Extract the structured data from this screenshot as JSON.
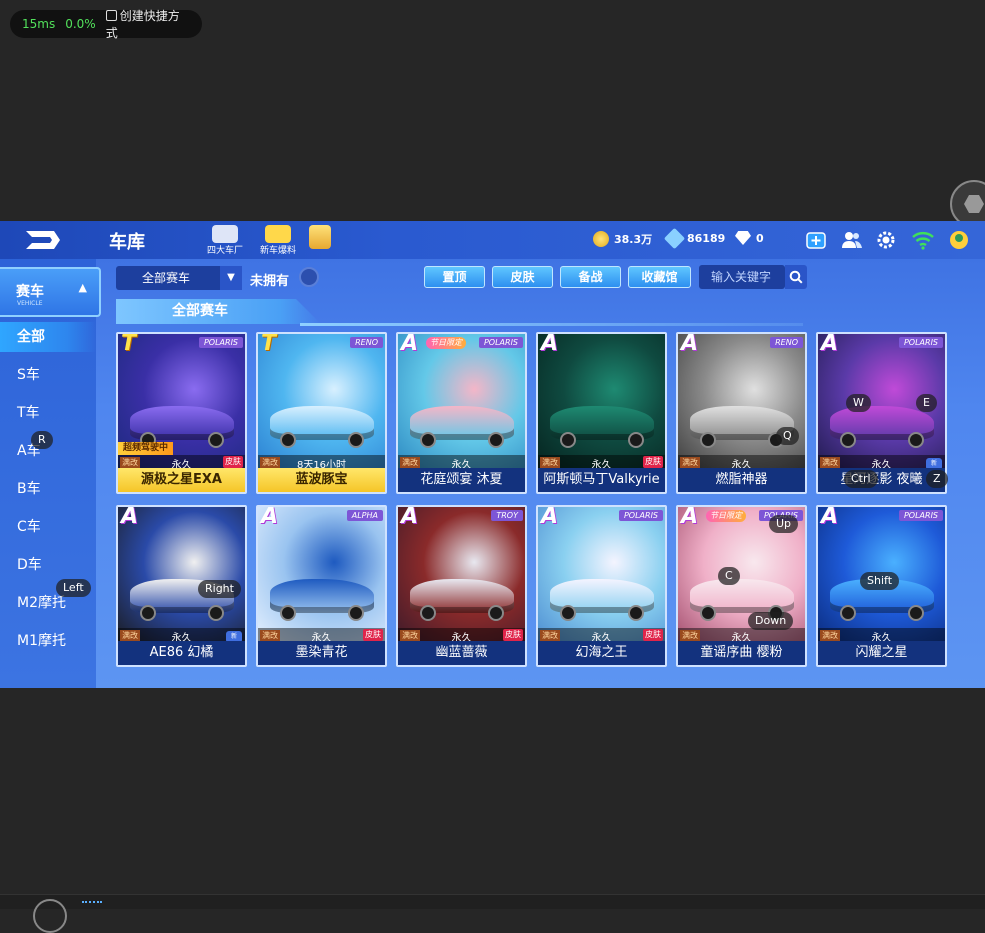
{
  "overlay": {
    "latency": "15ms",
    "loss": "0.0%",
    "shortcut_label": "创建快捷方式"
  },
  "header": {
    "title": "车库",
    "nav_icons": [
      {
        "label": "四大车厂",
        "icon": "factory-icon"
      },
      {
        "label": "新车爆料",
        "icon": "new-car-icon"
      },
      {
        "label": "",
        "icon": "gift-icon"
      }
    ],
    "currencies": [
      {
        "icon": "coin-icon",
        "value": "38.3万"
      },
      {
        "icon": "gem-icon",
        "value": "86189"
      },
      {
        "icon": "diamond-icon",
        "value": "0"
      }
    ],
    "right_icons": [
      "add-icon",
      "friends-icon",
      "settings-icon",
      "wifi-icon",
      "avatar-icon"
    ]
  },
  "sidebar": {
    "category": {
      "title": "赛车",
      "subtitle": "VEHICLE"
    },
    "items": [
      {
        "label": "全部",
        "active": true
      },
      {
        "label": "S车",
        "active": false
      },
      {
        "label": "T车",
        "active": false
      },
      {
        "label": "A车",
        "active": false
      },
      {
        "label": "B车",
        "active": false
      },
      {
        "label": "C车",
        "active": false
      },
      {
        "label": "D车",
        "active": false
      },
      {
        "label": "M2摩托",
        "active": false
      },
      {
        "label": "M1摩托",
        "active": false
      }
    ]
  },
  "filters": {
    "dropdown_value": "全部赛车",
    "unowned_label": "未拥有",
    "buttons": [
      "置顶",
      "皮肤",
      "备战",
      "收藏馆"
    ],
    "search_placeholder": "输入关键字"
  },
  "section_title": "全部赛车",
  "cars": [
    {
      "name": "源极之星EXA",
      "grade": "T",
      "brand": "POLARIS",
      "mod": "满改",
      "ownership": "永久",
      "skin": "皮肤",
      "ribbon": "超频驾驶中",
      "gold": true,
      "colors": [
        "#3a2fa6",
        "#8a6cf0",
        "#1a2a7a"
      ]
    },
    {
      "name": "蓝波豚宝",
      "grade": "T",
      "brand": "RENO",
      "mod": "满改",
      "ownership": "8天16小时",
      "skin": "",
      "gold": true,
      "colors": [
        "#4fb6f0",
        "#d8f0ff",
        "#2a7ed0"
      ]
    },
    {
      "name": "花庭颂宴 沐夏",
      "grade": "A",
      "brand": "POLARIS",
      "event": "节日限定",
      "mod": "满改",
      "ownership": "永久",
      "skin": "",
      "colors": [
        "#63c8e8",
        "#f4b6c8",
        "#2a86c0"
      ]
    },
    {
      "name": "阿斯顿马丁Valkyrie",
      "grade": "A",
      "brand": "",
      "mod": "满改",
      "ownership": "永久",
      "skin": "皮肤",
      "colors": [
        "#0f4a40",
        "#1e8a72",
        "#05221e"
      ]
    },
    {
      "name": "燃脂神器",
      "grade": "A",
      "brand": "RENO",
      "mod": "满改",
      "ownership": "永久",
      "skin": "",
      "colors": [
        "#8a8a8a",
        "#e0e0e0",
        "#3a3a3a"
      ]
    },
    {
      "name": "星河逐影 夜曦",
      "grade": "A",
      "brand": "POLARIS",
      "mod": "满改",
      "ownership": "永久",
      "skin": "",
      "side_badge": "新",
      "colors": [
        "#5a3aa8",
        "#c04ad8",
        "#1e1a4a"
      ]
    },
    {
      "name": "AE86 幻橘",
      "grade": "A",
      "brand": "",
      "mod": "满改",
      "ownership": "永久",
      "skin": "",
      "side_badge": "新",
      "colors": [
        "#2a4aa8",
        "#f0f0f0",
        "#1a1a1a"
      ]
    },
    {
      "name": "墨染青花",
      "grade": "A",
      "brand": "ALPHA",
      "mod": "满改",
      "ownership": "永久",
      "skin": "皮肤",
      "colors": [
        "#9ac4f0",
        "#1e5ac0",
        "#e8f2ff"
      ]
    },
    {
      "name": "幽蓝蔷薇",
      "grade": "A",
      "brand": "TROY",
      "mod": "满改",
      "ownership": "永久",
      "skin": "皮肤",
      "colors": [
        "#8a2a2a",
        "#e8e8f0",
        "#3a1a2a"
      ]
    },
    {
      "name": "幻海之王",
      "grade": "A",
      "brand": "POLARIS",
      "mod": "满改",
      "ownership": "永久",
      "skin": "皮肤",
      "colors": [
        "#8ad0f0",
        "#f4f4ff",
        "#4a8ad0"
      ]
    },
    {
      "name": "童谣序曲 樱粉",
      "grade": "A",
      "brand": "POLARIS",
      "event": "节日限定",
      "mod": "满改",
      "ownership": "永久",
      "skin": "",
      "colors": [
        "#f0b0c8",
        "#f8e8ee",
        "#a04a6a"
      ]
    },
    {
      "name": "闪耀之星",
      "grade": "A",
      "brand": "POLARIS",
      "mod": "满改",
      "ownership": "永久",
      "skin": "",
      "colors": [
        "#1e5ad8",
        "#4ab0ff",
        "#0a2a7a"
      ]
    }
  ],
  "key_hints": [
    "R",
    "Left",
    "W",
    "E",
    "Q",
    "Ctrl",
    "Z",
    "Right",
    "Up",
    "C",
    "Down",
    "Shift"
  ]
}
